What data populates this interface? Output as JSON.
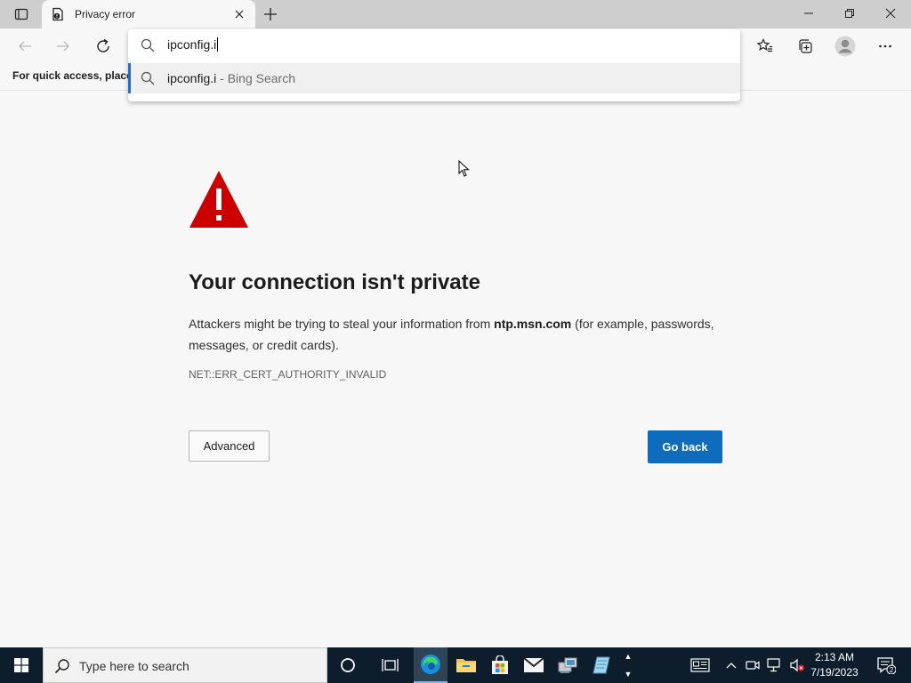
{
  "tab": {
    "title": "Privacy error"
  },
  "favorites_bar": {
    "text": "For quick access, place y"
  },
  "omnibox": {
    "input_value": "ipconfig.i",
    "suggestion_query": "ipconfig.i",
    "suggestion_suffix": " - Bing Search"
  },
  "error_page": {
    "headline": "Your connection isn't private",
    "desc_before": "Attackers might be trying to steal your information from ",
    "desc_host": "ntp.msn.com",
    "desc_after": " (for example, passwords, messages, or credit cards).",
    "error_code": "NET::ERR_CERT_AUTHORITY_INVALID",
    "advanced_label": "Advanced",
    "go_back_label": "Go back"
  },
  "taskbar": {
    "search_placeholder": "Type here to search",
    "time": "2:13 AM",
    "date": "7/19/2023",
    "notification_count": "2"
  },
  "colors": {
    "accent": "#0f6cbd",
    "warning_red": "#cc0000",
    "taskbar_bg": "#0e1d2b"
  }
}
